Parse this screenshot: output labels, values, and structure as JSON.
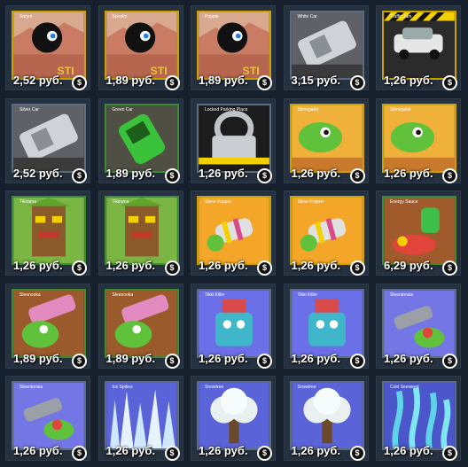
{
  "badge_glyph": "$",
  "items": [
    {
      "name": "Sorym",
      "price": "2,52 руб.",
      "scene": "blob",
      "color": "#d9a98f",
      "border": "#c9a100"
    },
    {
      "name": "Spooky",
      "price": "1,89 руб.",
      "scene": "blob",
      "color": "#d9a98f",
      "border": "#c9a100"
    },
    {
      "name": "Poppie",
      "price": "1,89 руб.",
      "scene": "blob",
      "color": "#d9a98f",
      "border": "#c9a100"
    },
    {
      "name": "White Car",
      "price": "3,15 руб.",
      "scene": "car",
      "color": "#5f6166",
      "border": "#5a6c80"
    },
    {
      "name": "Traffic Jam",
      "price": "1,26 руб.",
      "scene": "jam",
      "color": "#2b2b2b",
      "border": "#c9a100"
    },
    {
      "name": "Silver Car",
      "price": "2,52 руб.",
      "scene": "car",
      "color": "#5f6166",
      "border": "#5a6c80"
    },
    {
      "name": "Green Car",
      "price": "1,89 руб.",
      "scene": "greencar",
      "color": "#4f5043",
      "border": "#3c8b33"
    },
    {
      "name": "Locked Parking Place",
      "price": "1,26 руб.",
      "scene": "lock",
      "color": "#1c1c1c",
      "border": "#5a6c80"
    },
    {
      "name": "Slimegator",
      "price": "1,26 руб.",
      "scene": "slime",
      "color": "#f0b13a",
      "border": "#c9a100"
    },
    {
      "name": "Slimegator",
      "price": "1,26 руб.",
      "scene": "slime",
      "color": "#f0b13a",
      "border": "#c9a100"
    },
    {
      "name": "Tikirama",
      "price": "1,26 руб.",
      "scene": "tiki",
      "color": "#7bb544",
      "border": "#3c8b33"
    },
    {
      "name": "Tikirama",
      "price": "1,26 руб.",
      "scene": "tiki",
      "color": "#7bb544",
      "border": "#3c8b33"
    },
    {
      "name": "Slime Popper",
      "price": "1,26 руб.",
      "scene": "popper",
      "color": "#f3a628",
      "border": "#c9a100"
    },
    {
      "name": "Slime Popper",
      "price": "1,26 руб.",
      "scene": "popper",
      "color": "#f3a628",
      "border": "#c9a100"
    },
    {
      "name": "Energy Sauce",
      "price": "6,29 руб.",
      "scene": "energy",
      "color": "#a05a2c",
      "border": "#3c8b33"
    },
    {
      "name": "Sleenooka",
      "price": "1,89 руб.",
      "scene": "bazooka",
      "color": "#9a5a2b",
      "border": "#3c8b33"
    },
    {
      "name": "Sleenooka",
      "price": "1,89 руб.",
      "scene": "bazooka",
      "color": "#9a5a2b",
      "border": "#3c8b33"
    },
    {
      "name": "Tikki Killer",
      "price": "1,26 руб.",
      "scene": "robot",
      "color": "#6b6fe8",
      "border": "#5a6c80"
    },
    {
      "name": "Tikki Killer",
      "price": "1,26 руб.",
      "scene": "robot",
      "color": "#6b6fe8",
      "border": "#5a6c80"
    },
    {
      "name": "Sleentonsia",
      "price": "1,26 руб.",
      "scene": "gun",
      "color": "#7476e6",
      "border": "#5a6c80"
    },
    {
      "name": "Sleentonsia",
      "price": "1,26 руб.",
      "scene": "gun",
      "color": "#7476e6",
      "border": "#5a6c80"
    },
    {
      "name": "Ice Spikes",
      "price": "1,26 руб.",
      "scene": "ice",
      "color": "#5b63d8",
      "border": "#5a6c80"
    },
    {
      "name": "Snowtree",
      "price": "1,26 руб.",
      "scene": "tree",
      "color": "#5b63d8",
      "border": "#5a6c80"
    },
    {
      "name": "Snowtree",
      "price": "1,26 руб.",
      "scene": "tree",
      "color": "#5b63d8",
      "border": "#5a6c80"
    },
    {
      "name": "Cold Seeweed",
      "price": "1,26 руб.",
      "scene": "seaweed",
      "color": "#4a56c9",
      "border": "#5a6c80"
    }
  ]
}
